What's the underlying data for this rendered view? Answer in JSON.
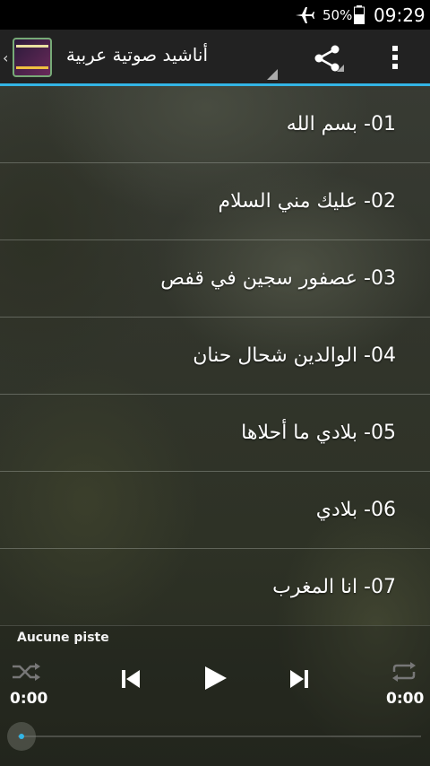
{
  "status_bar": {
    "battery_percent": "50%",
    "time": "09:29",
    "icons": [
      "airplane-mode-icon",
      "battery-icon"
    ]
  },
  "action_bar": {
    "title": "أناشيد صوتية عربية",
    "icons": [
      "up-caret-icon",
      "app-icon",
      "share-icon",
      "overflow-menu-icon"
    ],
    "accent_color": "#33b5e5"
  },
  "tracks": [
    "01- بسم الله",
    "02- عليك مني السلام",
    "03- عصفور سجين في قفص",
    "04- الوالدين شحال حنان",
    "05- بلادي ما أحلاها",
    "06- بلادي",
    "07- انا المغرب"
  ],
  "player": {
    "now_playing": "Aucune piste",
    "elapsed": "0:00",
    "duration": "0:00",
    "progress": 0,
    "icons": [
      "shuffle-icon",
      "previous-icon",
      "play-icon",
      "next-icon",
      "repeat-icon"
    ]
  }
}
